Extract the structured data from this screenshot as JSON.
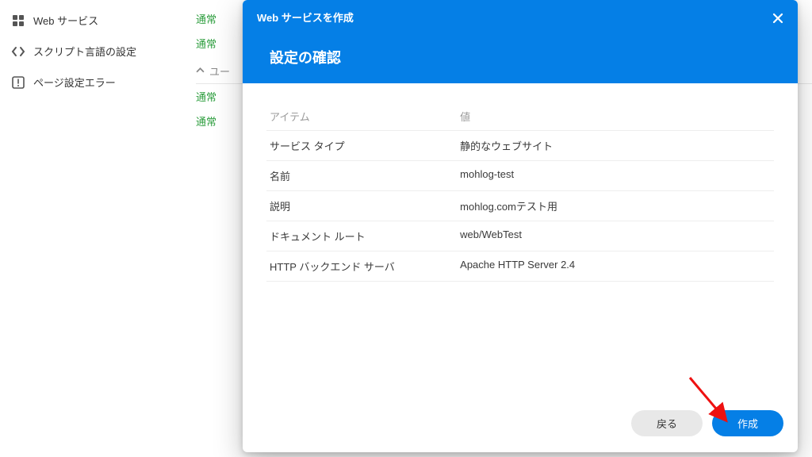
{
  "sidebar": {
    "items": [
      {
        "label": "Web サービス"
      },
      {
        "label": "スクリプト言語の設定"
      },
      {
        "label": "ページ設定エラー"
      }
    ]
  },
  "main": {
    "status_rows": [
      "通常",
      "通常"
    ],
    "group_label": "ユー",
    "group_rows": [
      "通常",
      "通常"
    ]
  },
  "modal": {
    "title_small": "Web サービスを作成",
    "title_big": "設定の確認",
    "col_item": "アイテム",
    "col_value": "値",
    "rows": [
      {
        "item": "サービス タイプ",
        "value": "静的なウェブサイト"
      },
      {
        "item": "名前",
        "value": "mohlog-test"
      },
      {
        "item": "説明",
        "value": "mohlog.comテスト用"
      },
      {
        "item": "ドキュメント ルート",
        "value": "web/WebTest"
      },
      {
        "item": "HTTP バックエンド サーバ",
        "value": "Apache HTTP Server 2.4"
      }
    ],
    "back_label": "戻る",
    "create_label": "作成"
  }
}
